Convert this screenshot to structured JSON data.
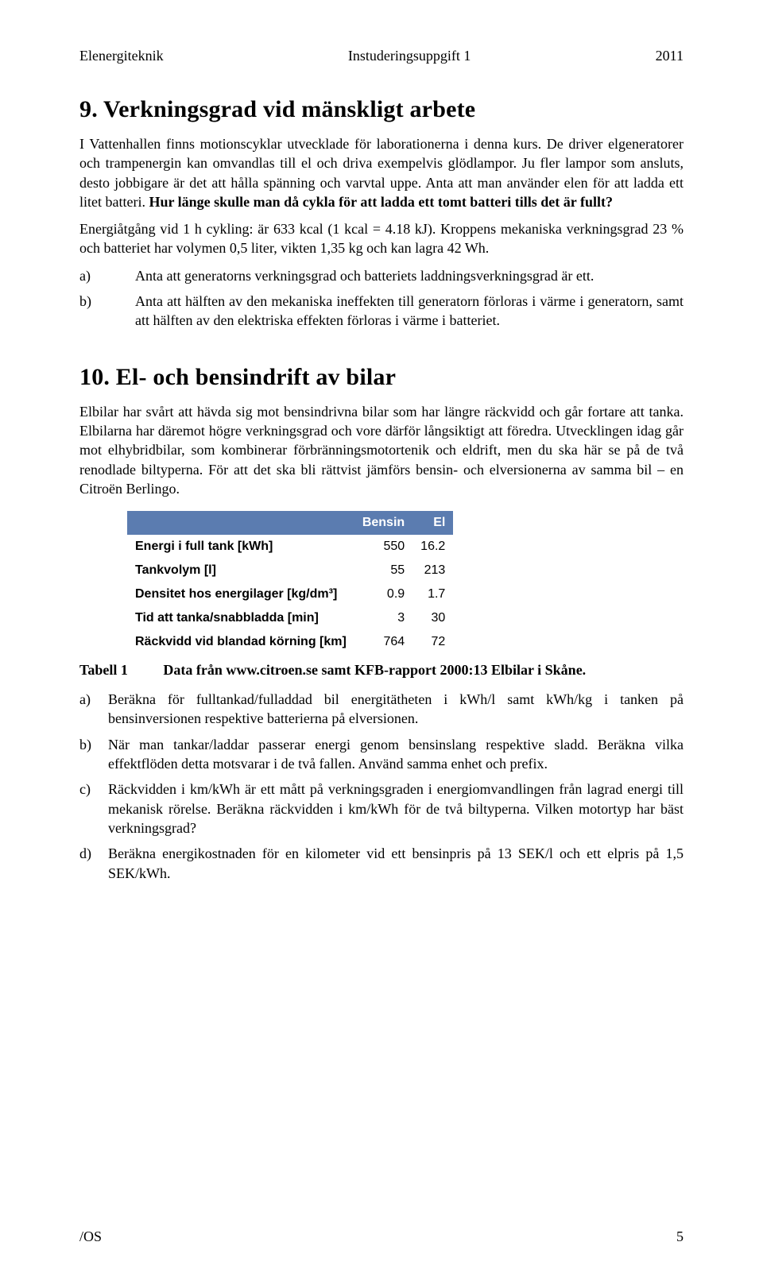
{
  "header": {
    "left": "Elenergiteknik",
    "center": "Instuderingsuppgift 1",
    "right": "2011"
  },
  "section9": {
    "title": "9.    Verkningsgrad vid mänskligt arbete",
    "p1a": "I Vattenhallen finns motionscyklar utvecklade för laborationerna i denna kurs. De driver elgeneratorer och trampenergin kan omvandlas till el och driva exempelvis glödlampor. Ju fler lampor som ansluts, desto jobbigare är det att hålla spänning och varvtal uppe. Anta att man använder elen för att ladda ett litet batteri. ",
    "p1b": "Hur länge skulle man då cykla för att ladda ett tomt batteri tills det är fullt?",
    "p2": "Energiåtgång vid 1 h cykling: är 633 kcal (1 kcal = 4.18 kJ). Kroppens mekaniska verkningsgrad 23 % och batteriet har volymen 0,5 liter, vikten 1,35 kg och kan lagra 42 Wh.",
    "items": [
      {
        "marker": "a)",
        "text": "Anta att generatorns verkningsgrad och batteriets laddningsverkningsgrad är ett."
      },
      {
        "marker": "b)",
        "text": "Anta att hälften av den mekaniska ineffekten till generatorn förloras i värme i generatorn, samt att hälften av den elektriska effekten förloras i värme i batteriet."
      }
    ]
  },
  "section10": {
    "title": "10. El- och bensindrift av bilar",
    "p1": "Elbilar har svårt att hävda sig mot bensindrivna bilar som har längre räckvidd och går fortare att tanka. Elbilarna har däremot högre verkningsgrad och vore därför långsiktigt att föredra. Utvecklingen idag går mot elhybridbilar, som kombinerar förbränningsmotortenik och eldrift, men du ska här se på de två renodlade biltyperna. För att det ska bli rättvist jämförs bensin- och elversionerna av samma bil – en Citroën Berlingo.",
    "table": {
      "head": {
        "c1": "",
        "c2": "Bensin",
        "c3": "El"
      },
      "rows": [
        {
          "label": "Energi i full tank [kWh]",
          "bensin": "550",
          "el": "16.2"
        },
        {
          "label": "Tankvolym [l]",
          "bensin": "55",
          "el": "213"
        },
        {
          "label": "Densitet hos energilager [kg/dm³]",
          "bensin": "0.9",
          "el": "1.7"
        },
        {
          "label": "Tid att tanka/snabbladda [min]",
          "bensin": "3",
          "el": "30"
        },
        {
          "label": "Räckvidd vid blandad körning [km]",
          "bensin": "764",
          "el": "72"
        }
      ]
    },
    "caption": {
      "label": "Tabell 1",
      "text": "Data från www.citroen.se samt KFB-rapport 2000:13 Elbilar i Skåne."
    },
    "items": [
      {
        "marker": "a)",
        "text": "Beräkna för fulltankad/fulladdad bil energitätheten i kWh/l samt kWh/kg i tanken på bensinversionen respektive batterierna på elversionen."
      },
      {
        "marker": "b)",
        "text": "När man tankar/laddar passerar energi genom bensinslang respektive sladd. Beräkna vilka effektflöden detta motsvarar i de två fallen. Använd samma enhet och prefix."
      },
      {
        "marker": "c)",
        "text": "Räckvidden i km/kWh är ett mått på verkningsgraden i energiomvandlingen från lagrad energi till mekanisk rörelse. Beräkna räckvidden i km/kWh för de två biltyperna. Vilken motortyp har bäst verkningsgrad?"
      },
      {
        "marker": "d)",
        "text": "Beräkna energikostnaden för en kilometer vid ett bensinpris på 13 SEK/l och ett elpris på 1,5 SEK/kWh."
      }
    ]
  },
  "footer": {
    "left": "/OS",
    "right": "5"
  }
}
